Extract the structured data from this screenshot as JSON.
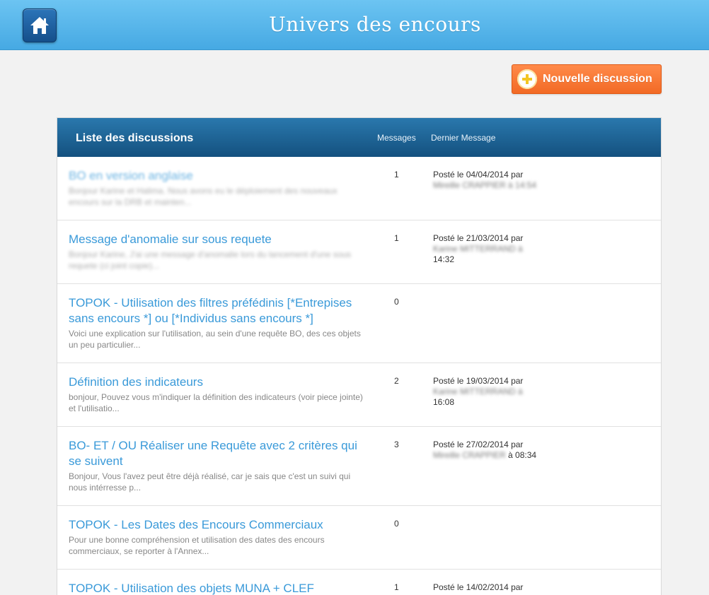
{
  "header": {
    "title": "Univers des encours",
    "home_icon": "home-icon"
  },
  "toolbar": {
    "new_discussion_label": "Nouvelle discussion",
    "plus_icon": "plus-circle-icon",
    "accent_color": "#f26a25"
  },
  "list": {
    "title": "Liste des discussions",
    "col_messages": "Messages",
    "col_last": "Dernier Message",
    "rows": [
      {
        "title": "BO en version anglaise",
        "excerpt": "Bonjour Karine et Halima. Nous avons eu le déploiement des nouveaux encours sur la DRB et mainten...",
        "count": "1",
        "last_line1": "Posté le 04/04/2014 par",
        "last_name": "Mireille CRAPPIER à 14:54",
        "last_time": ""
      },
      {
        "title": "Message d'anomalie sur sous requete",
        "excerpt": "Bonjour Karine, J'ai une message d'anomalie lors du lancement d'une sous requete (ci joint copie)...",
        "count": "1",
        "last_line1": "Posté le 21/03/2014 par",
        "last_name": "Karine MITTERRAND à",
        "last_time": "14:32"
      },
      {
        "title": "TOPOK - Utilisation des filtres préfédinis [*Entrepises sans encours *] ou [*Individus sans encours *]",
        "excerpt": "Voici une explication sur l'utilisation, au sein d'une requête BO, des ces objets un peu particulier...",
        "count": "0",
        "last_line1": "",
        "last_name": "",
        "last_time": ""
      },
      {
        "title": "Définition des indicateurs",
        "excerpt": "bonjour, Pouvez vous m'indiquer la définition des indicateurs (voir piece jointe) et l'utilisatio...",
        "count": "2",
        "last_line1": "Posté le 19/03/2014 par",
        "last_name": "Karine MITTERRAND à",
        "last_time": "16:08"
      },
      {
        "title": "BO- ET / OU Réaliser une Requête avec 2 critères qui se suivent",
        "excerpt": "Bonjour, Vous l'avez peut être déjà réalisé, car je sais que c'est un suivi qui nous intérresse p...",
        "count": "3",
        "last_line1": "Posté le 27/02/2014 par",
        "last_name": "Mireille CRAPPIER",
        "last_time": "à 08:34"
      },
      {
        "title": "TOPOK - Les Dates des Encours Commerciaux",
        "excerpt": "Pour une bonne compréhension et utilisation des dates des encours commerciaux, se reporter à l'Annex...",
        "count": "0",
        "last_line1": "",
        "last_name": "",
        "last_time": ""
      },
      {
        "title": "TOPOK - Utilisation des objets MUNA + CLEF",
        "excerpt": "",
        "count": "1",
        "last_line1": "Posté le 14/02/2014 par",
        "last_name": "",
        "last_time": ""
      }
    ]
  }
}
